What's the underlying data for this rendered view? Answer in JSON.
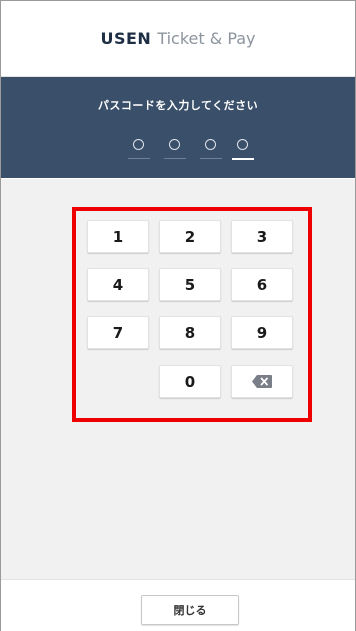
{
  "header": {
    "brand_bold": "USEN",
    "brand_light": "Ticket & Pay"
  },
  "passcode": {
    "prompt": "パスコードを入力してください",
    "digit_count": 4,
    "active_index": 3
  },
  "keypad": {
    "keys": [
      {
        "label": "1"
      },
      {
        "label": "2"
      },
      {
        "label": "3"
      },
      {
        "label": "4"
      },
      {
        "label": "5"
      },
      {
        "label": "6"
      },
      {
        "label": "7"
      },
      {
        "label": "8"
      },
      {
        "label": "9"
      },
      {
        "label": "0"
      }
    ],
    "delete_icon": "backspace-icon"
  },
  "footer": {
    "close_label": "閉じる"
  },
  "colors": {
    "panel": "#3a4f6a",
    "highlight": "#ee0000",
    "brand": "#1e2f45"
  }
}
